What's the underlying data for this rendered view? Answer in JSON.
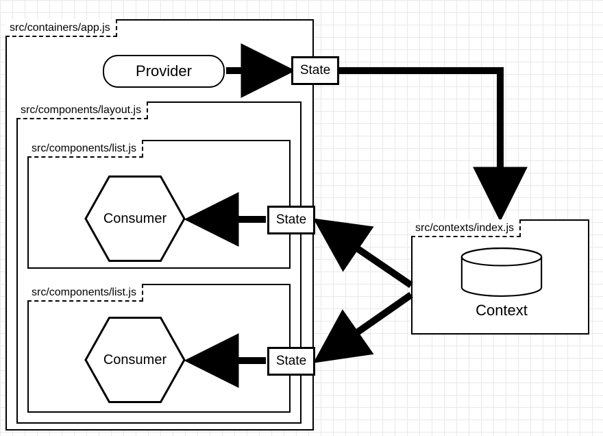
{
  "diagram": {
    "files": {
      "app": "src/containers/app.js",
      "layout": "src/components/layout.js",
      "list1": "src/components/list.js",
      "list2": "src/components/list.js",
      "contexts": "src/contexts/index.js"
    },
    "nodes": {
      "provider": "Provider",
      "state_top": "State",
      "state_mid": "State",
      "state_bot": "State",
      "consumer1": "Consumer",
      "consumer2": "Consumer",
      "context": "Context"
    },
    "edges": [
      {
        "from": "provider",
        "to": "state_top"
      },
      {
        "from": "state_top",
        "to": "context"
      },
      {
        "from": "context",
        "to": "state_mid"
      },
      {
        "from": "context",
        "to": "state_bot"
      },
      {
        "from": "state_mid",
        "to": "consumer1"
      },
      {
        "from": "state_bot",
        "to": "consumer2"
      }
    ]
  }
}
